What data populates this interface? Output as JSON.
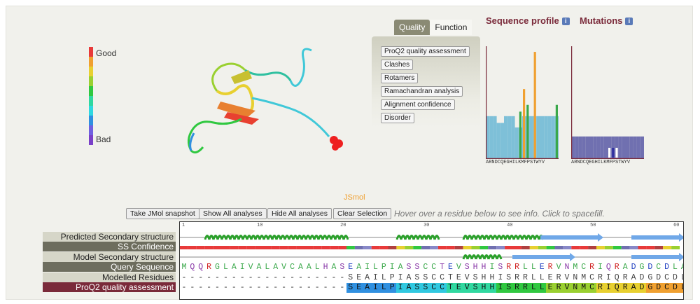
{
  "legend": {
    "good_label": "Good",
    "bad_label": "Bad",
    "colors": [
      "#e83a3a",
      "#f0a030",
      "#e8d030",
      "#9ad030",
      "#30c840",
      "#30d8a0",
      "#30d8e0",
      "#3090e0",
      "#7060e0",
      "#7a40c8"
    ]
  },
  "viewer": {
    "engine_label": "JSmol"
  },
  "tabs": [
    {
      "label": "Quality",
      "active": true
    },
    {
      "label": "Function",
      "active": false
    }
  ],
  "analysis_buttons": [
    "ProQ2 quality assessment",
    "Clashes",
    "Rotamers",
    "Ramachandran analysis",
    "Alignment confidence",
    "Disorder"
  ],
  "sequence_profile": {
    "title": "Sequence profile",
    "axis": "ARNDCQEGHILKMFPSTWYV"
  },
  "mutations": {
    "title": "Mutations",
    "axis": "ARNDCQEGHILKMFPSTWYV"
  },
  "chart_data": [
    {
      "type": "bar",
      "title": "Sequence profile",
      "categories": [
        "A",
        "R",
        "N",
        "D",
        "C",
        "Q",
        "E",
        "G",
        "H",
        "I",
        "L",
        "K",
        "M",
        "F",
        "P",
        "S",
        "T",
        "W",
        "Y",
        "V"
      ],
      "series": [
        {
          "values": [
            0.38,
            0.38,
            0.38,
            0.32,
            0.32,
            0.38,
            0.38,
            0.38,
            0.28,
            0.28,
            0.38,
            0.38,
            0.38,
            0.38,
            0.38,
            0.38,
            0.38,
            0.38,
            0.38,
            0.38
          ]
        },
        {
          "values": [
            0,
            0,
            0,
            0,
            0,
            0,
            0,
            0,
            0,
            0.42,
            0.62,
            0.48,
            0,
            0.95,
            0,
            0,
            0,
            0,
            0,
            0.48
          ]
        }
      ],
      "ylim": [
        0,
        1
      ]
    },
    {
      "type": "bar",
      "title": "Mutations",
      "categories": [
        "A",
        "R",
        "N",
        "D",
        "C",
        "Q",
        "E",
        "G",
        "H",
        "I",
        "L",
        "K",
        "M",
        "F",
        "P",
        "S",
        "T",
        "W",
        "Y",
        "V"
      ],
      "values": [
        0.2,
        0.2,
        0.2,
        0.2,
        0.2,
        0.2,
        0.2,
        0.2,
        0.2,
        0.2,
        0.2,
        0.2,
        0.2,
        0.2,
        0.2,
        0.2,
        0.2,
        0.2,
        0.2,
        0.2
      ],
      "ylim": [
        0,
        1
      ]
    }
  ],
  "toolbar": {
    "snapshot": "Take JMol snapshot",
    "show_all": "Show All analyses",
    "hide_all": "Hide All analyses",
    "clear": "Clear Selection",
    "hint": "Hover over a residue below to see info. Click to spacefill."
  },
  "tracks": [
    {
      "label": "Predicted Secondary structure",
      "style": "light"
    },
    {
      "label": "SS Confidence",
      "style": "dark"
    },
    {
      "label": "Model Secondary structure",
      "style": "light"
    },
    {
      "label": "Query Sequence",
      "style": "dark"
    },
    {
      "label": "Modelled Residues",
      "style": "light"
    },
    {
      "label": "ProQ2 quality assessment",
      "style": "red"
    }
  ],
  "ruler": [
    "1",
    "10",
    "20",
    "30",
    "40",
    "50",
    "60"
  ],
  "query_sequence": "MQQRGLAIVALAVCAALHASEAILPIASSCCTEVSHHISRRLLERVNMCRIQRADGDCDLAAVILHV",
  "modelled_residues": "--------------------SEAILPIASSCCTEVSHHISRRLLERVNMCRIQRADGDCDLAAVILHV",
  "proq2_sequence": "--------------------SEAILPIASSCCTEVSHHISRRLLERVNMCRIQRADGDCDLAAVILHV"
}
